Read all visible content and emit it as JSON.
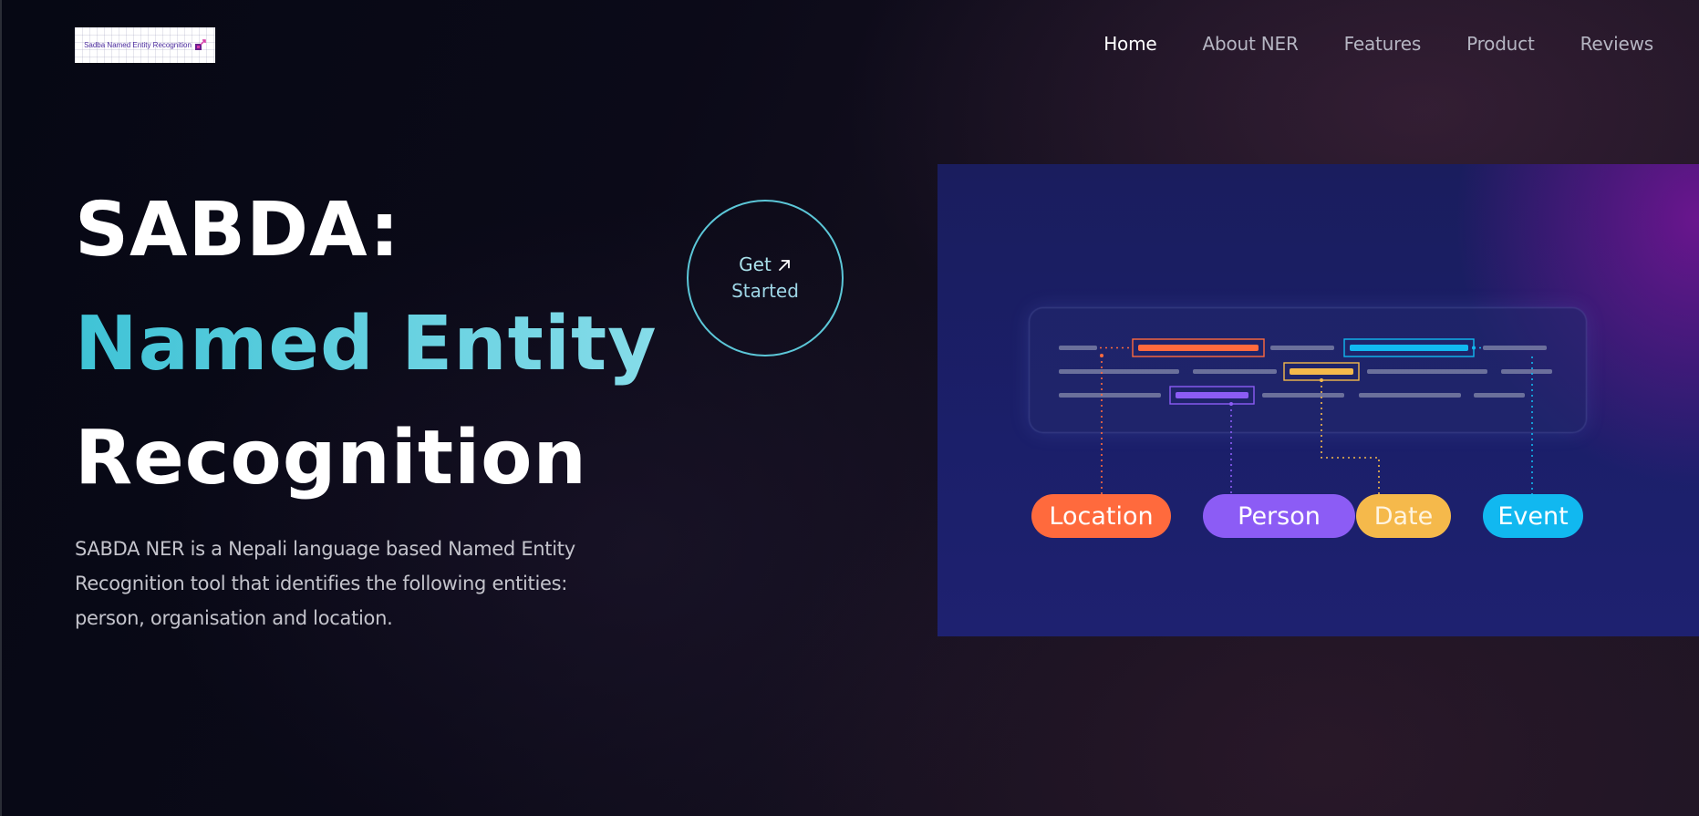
{
  "logo": {
    "text": "Sadba Named Entity Recognition"
  },
  "nav": {
    "items": [
      {
        "label": "Home",
        "active": true
      },
      {
        "label": "About NER",
        "active": false
      },
      {
        "label": "Features",
        "active": false
      },
      {
        "label": "Product",
        "active": false
      },
      {
        "label": "Reviews",
        "active": false
      }
    ]
  },
  "hero": {
    "title_line1": "SABDA:",
    "title_line2": "Named Entity",
    "title_line3": "Recognition",
    "description": "SABDA NER is a Nepali language based Named Entity Recognition tool that identifies the following entities: person, organisation and location."
  },
  "cta": {
    "line1": "Get",
    "line2": "Started",
    "icon": "arrow-up-right-icon"
  },
  "illustration": {
    "entity_labels": [
      "Location",
      "Person",
      "Date",
      "Event"
    ],
    "colors": {
      "location": "#ff6a3d",
      "person": "#8c5cf5",
      "date": "#f5b94b",
      "event": "#11b8f0"
    }
  },
  "colors": {
    "accent": "#3fc3d6",
    "background": "#070812",
    "text_primary": "#ffffff",
    "text_muted": "#c4c4cc"
  }
}
